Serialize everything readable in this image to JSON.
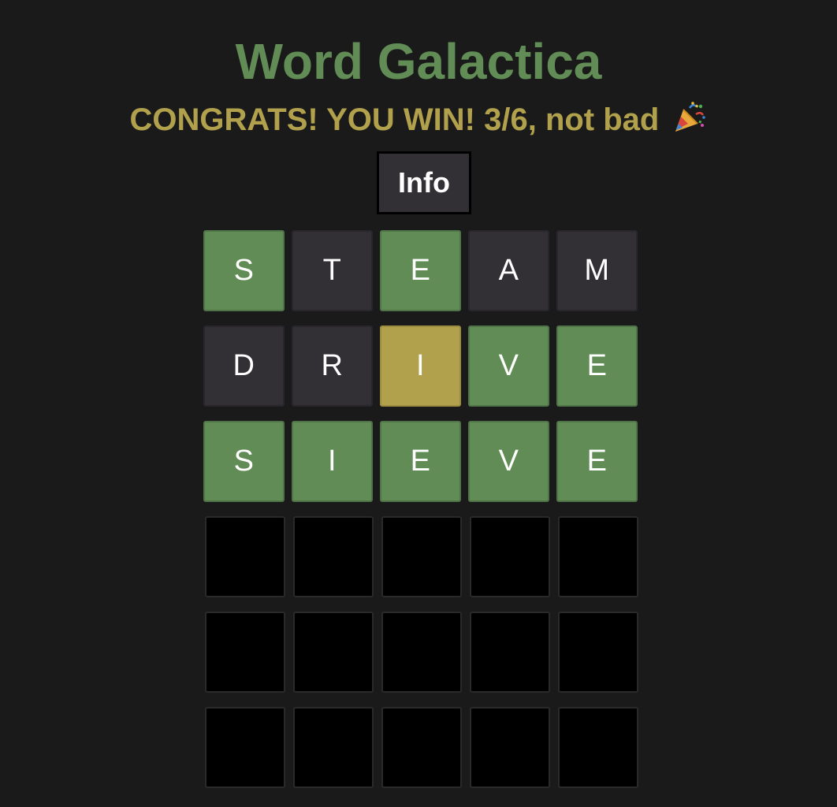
{
  "header": {
    "title": "Word Galactica",
    "status_text": "CONGRATS! YOU WIN! 3/6, not bad",
    "status_icon": "party-popper-icon",
    "info_label": "Info"
  },
  "colors": {
    "background": "#1a1a1a",
    "correct": "#618c55",
    "present": "#b1a04c",
    "absent": "#322f35",
    "empty": "#000000",
    "title": "#618c55",
    "status": "#b1a04c"
  },
  "board": {
    "rows": [
      {
        "letters": [
          "S",
          "T",
          "E",
          "A",
          "M"
        ],
        "states": [
          "correct",
          "absent",
          "correct",
          "absent",
          "absent"
        ]
      },
      {
        "letters": [
          "D",
          "R",
          "I",
          "V",
          "E"
        ],
        "states": [
          "absent",
          "absent",
          "present",
          "correct",
          "correct"
        ]
      },
      {
        "letters": [
          "S",
          "I",
          "E",
          "V",
          "E"
        ],
        "states": [
          "correct",
          "correct",
          "correct",
          "correct",
          "correct"
        ]
      },
      {
        "letters": [
          "",
          "",
          "",
          "",
          ""
        ],
        "states": [
          "empty",
          "empty",
          "empty",
          "empty",
          "empty"
        ]
      },
      {
        "letters": [
          "",
          "",
          "",
          "",
          ""
        ],
        "states": [
          "empty",
          "empty",
          "empty",
          "empty",
          "empty"
        ]
      },
      {
        "letters": [
          "",
          "",
          "",
          "",
          ""
        ],
        "states": [
          "empty",
          "empty",
          "empty",
          "empty",
          "empty"
        ]
      }
    ]
  }
}
